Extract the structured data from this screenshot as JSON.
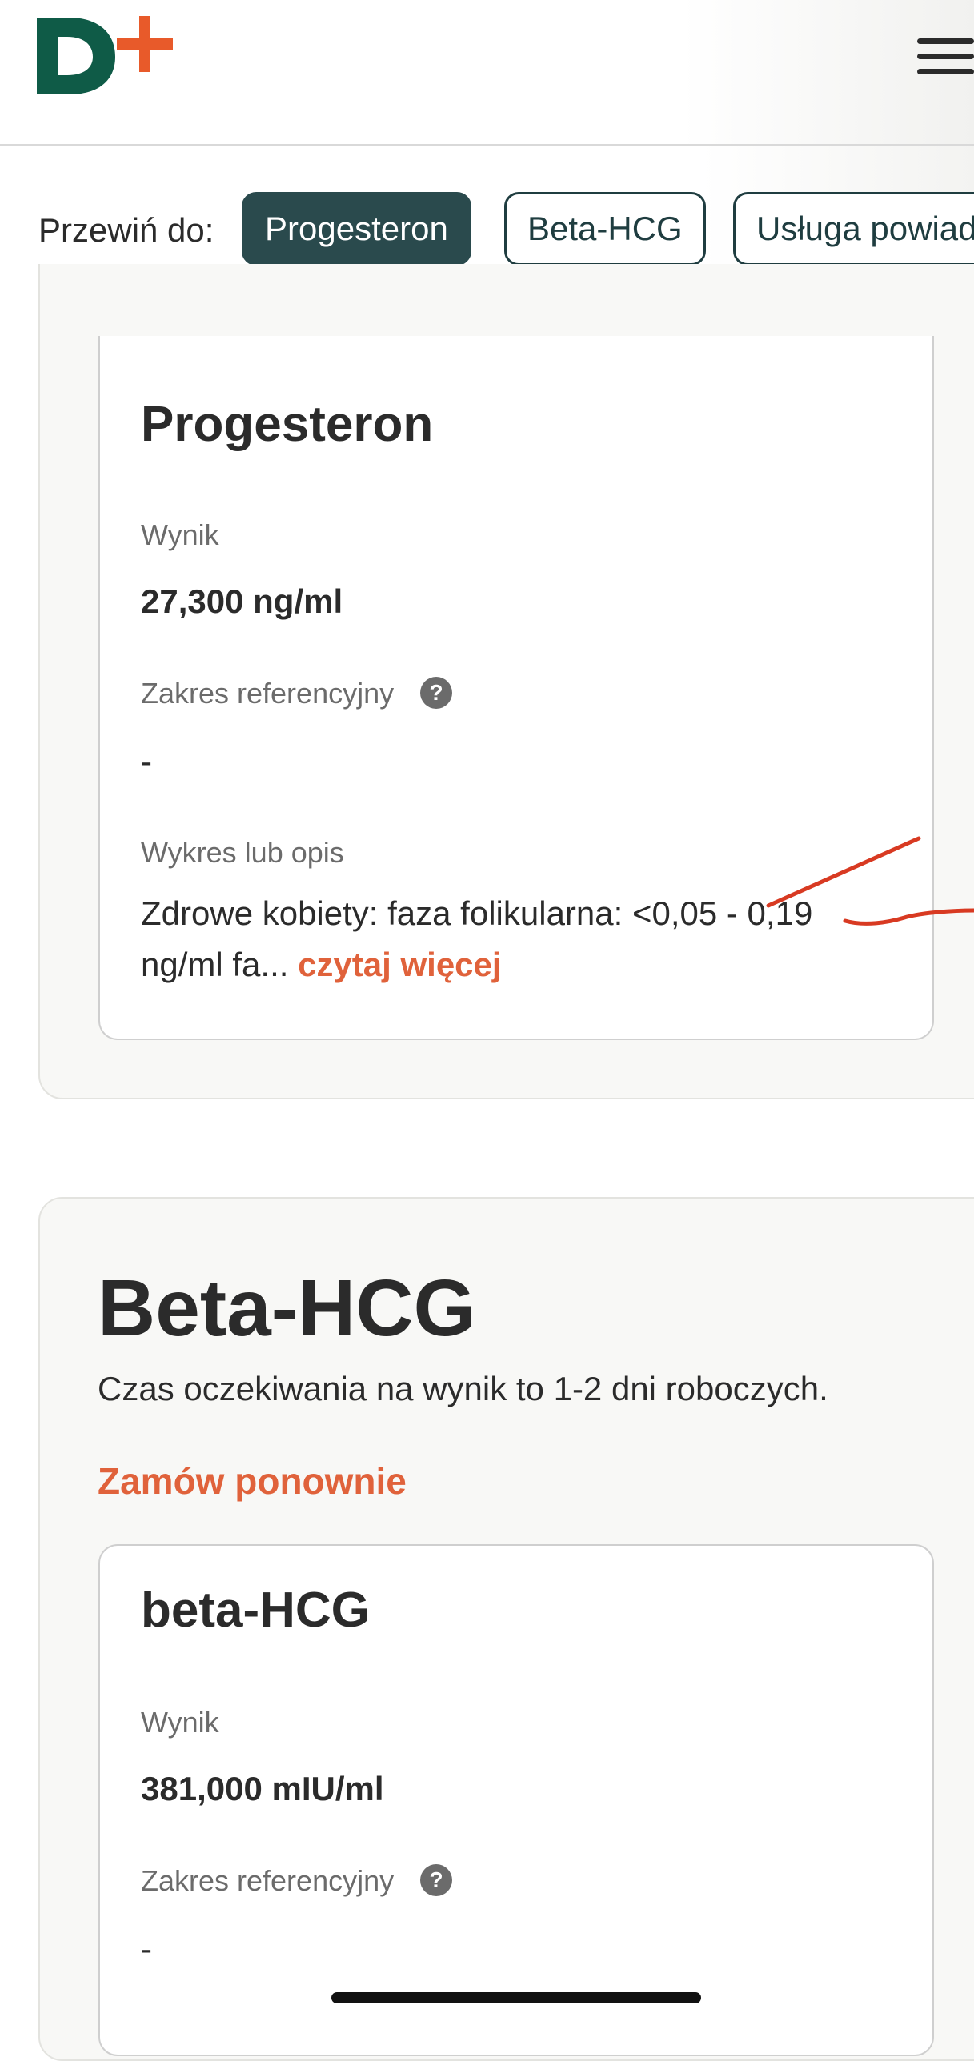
{
  "brand": {
    "name": "D+",
    "primary_color": "#0f5b47",
    "accent_color": "#e0623b"
  },
  "scroll_nav": {
    "label": "Przewiń do:",
    "chips": [
      {
        "label": "Progesteron",
        "active": true
      },
      {
        "label": "Beta-HCG",
        "active": false
      },
      {
        "label": "Usługa powiad",
        "active": false
      }
    ]
  },
  "progesteron_card": {
    "title": "Progesteron",
    "result_label": "Wynik",
    "result_value": "27,300 ng/ml",
    "ref_label": "Zakres referencyjny",
    "help_icon": "?",
    "ref_value": "-",
    "desc_label": "Wykres lub opis",
    "desc_text": "Zdrowe kobiety: faza folikularna: <0,05 - 0,19 ng/ml fa...",
    "read_more": "czytaj więcej"
  },
  "beta_section": {
    "title": "Beta-HCG",
    "subtitle": "Czas oczekiwania na wynik to 1-2 dni roboczych.",
    "reorder": "Zamów ponownie",
    "card": {
      "title": "beta-HCG",
      "result_label": "Wynik",
      "result_value": "381,000 mIU/ml",
      "ref_label": "Zakres referencyjny",
      "help_icon": "?",
      "ref_value": "-"
    }
  },
  "icons": [
    "logo-plus-icon",
    "hamburger-menu-icon",
    "help-circle-icon"
  ],
  "annotation_color": "#d83a22"
}
